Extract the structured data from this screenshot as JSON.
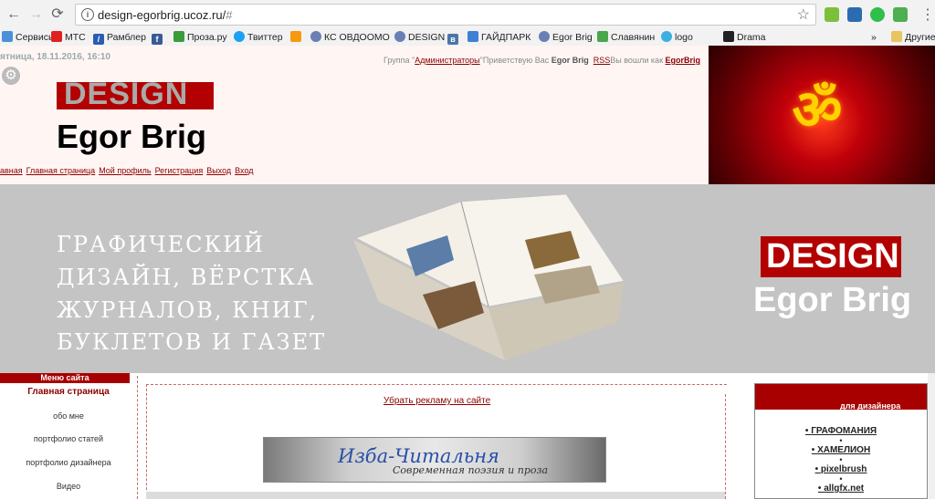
{
  "browser": {
    "url_host": "design-egorbrig.ucoz.ru/",
    "url_hash": "#",
    "bookmarks": [
      "Сервисы",
      "МТС",
      "Рамблер",
      "",
      "Проза.ру",
      "Твиттер",
      "",
      "КС ОВДООМО",
      "DESIGN",
      "",
      "ГАЙДПАРК",
      "Egor Brig",
      "Славянин",
      "logo",
      "Drama"
    ],
    "other_bookmarks": "Другие",
    "overflow": "»"
  },
  "header": {
    "date": "ятница, 18.11.2016, 16:10",
    "logo_design": "DESIGN",
    "logo_name": "Egor Brig",
    "user_bar": {
      "group_prefix": "Группа \"",
      "group_name": "Администраторы",
      "greeting": "\"Приветствую Вас ",
      "user": "Egor Brig",
      "rss": "RSS",
      "logged_as": "Вы вошли как ",
      "login": "EgorBrig"
    },
    "nav": [
      "авная",
      "Главная страница",
      "Мой профиль",
      "Регистрация",
      "Выход",
      "Вход"
    ]
  },
  "promo": {
    "lines": [
      "ГРАФИЧЕСКИЙ",
      "ДИЗАЙН, ВЁРСТКА",
      "ЖУРНАЛОВ, КНИГ,",
      "БУКЛЕТОВ  И  ГАЗЕТ"
    ],
    "logo_design": "DESIGN",
    "logo_name": "Egor Brig"
  },
  "menu": {
    "title": "Меню сайта",
    "items": [
      "Главная страница",
      "обо мне",
      "портфолио статей",
      "портфолио дизайнера",
      "Видео"
    ]
  },
  "main": {
    "remove_ads": "Убрать рекламу на сайте",
    "izba_title": "Изба-Читальня",
    "izba_sub": "Современная поэзия и проза"
  },
  "right": {
    "title": "для дизайнера",
    "links": [
      "ГРАФОМАНИЯ",
      "ХАМЕЛИОН",
      "pixelbrush",
      "allgfx.net"
    ]
  }
}
